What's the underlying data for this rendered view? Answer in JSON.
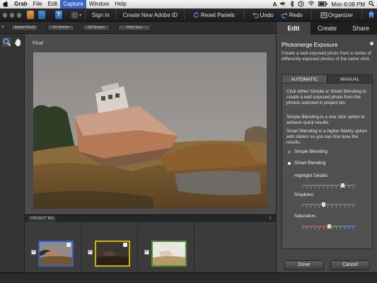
{
  "menubar": {
    "items": [
      "Grab",
      "File",
      "Edit",
      "Capture",
      "Window",
      "Help"
    ],
    "active_item": "Capture",
    "clock": "Mon 6:08 PM",
    "status_icons": [
      "adobe-icon",
      "volume-icon",
      "bluetooth-icon",
      "backup-icon",
      "wifi-icon",
      "battery-icon",
      "spotlight-icon"
    ]
  },
  "toolbar": {
    "sign_in": "Sign In",
    "create_id": "Create New Adobe ID",
    "reset_panels": "Reset Panels",
    "undo": "Undo",
    "redo": "Redo",
    "organizer": "Organizer"
  },
  "zoom_buttons": [
    "Actual Pixels",
    "Fit Screen",
    "Fill Screen",
    "Print Size"
  ],
  "canvas": {
    "label": "Final"
  },
  "project_bin": {
    "label": "PROJECT BIN",
    "thumbnails": [
      {
        "checked": true,
        "border_color": "#2b60d0"
      },
      {
        "checked": true,
        "border_color": "#c8b400"
      },
      {
        "checked": true,
        "border_color": "#4a8f2a"
      }
    ]
  },
  "panel": {
    "tabs": [
      "Edit",
      "Create",
      "Share"
    ],
    "active_tab": "Edit",
    "title": "Photomerge Exposure",
    "description": "Create a well exposed photo from a series of differently exposed photos of the same shot.",
    "mode_tabs": [
      "AUTOMATIC",
      "MANUAL"
    ],
    "active_mode": "AUTOMATIC",
    "instructions": "Click either Simple or Smart Blending to create a well exposed photo from the photos selected in project bin.",
    "simple_note": "Simple Blending is a one click option to achieve quick results.",
    "smart_note": "Smart Blending is a higher fidelity option with sliders so you can fine tune the results.",
    "options": [
      {
        "label": "Simple Blending",
        "selected": false
      },
      {
        "label": "Smart Blending",
        "selected": true
      }
    ],
    "sliders": [
      {
        "label": "Highlight Details:",
        "value": 0.78
      },
      {
        "label": "Shadows:",
        "value": 0.4
      },
      {
        "label": "Saturation:",
        "value": 0.5
      }
    ],
    "done": "Done",
    "cancel": "Cancel"
  },
  "colors": {
    "accent": "#3a65c9",
    "panel_bg": "#464646",
    "toolbar_bg": "#1c1c1c"
  }
}
